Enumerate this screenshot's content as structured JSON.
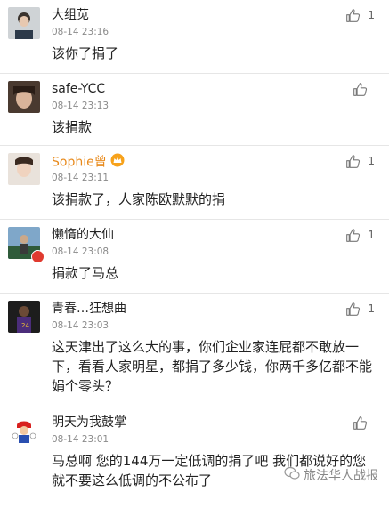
{
  "comments": [
    {
      "username": "大组苋",
      "time": "08-14 23:16",
      "content": "该你了捐了",
      "likes": "1"
    },
    {
      "username": "safe-YCC",
      "time": "08-14 23:13",
      "content": "该捐款",
      "likes": ""
    },
    {
      "username": "Sophie曾",
      "time": "08-14 23:11",
      "content": "该捐款了，人家陈欧默默的捐",
      "likes": "1"
    },
    {
      "username": "懒惰的大仙",
      "time": "08-14 23:08",
      "content": "捐款了马总",
      "likes": "1"
    },
    {
      "username": "青春…狂想曲",
      "time": "08-14 23:03",
      "content": "这天津出了这么大的事，你们企业家连屁都不敢放一下，看看人家明星，都捐了多少钱，你两千多亿都不能娟个零头？",
      "likes": "1"
    },
    {
      "username": "明天为我鼓掌",
      "time": "08-14 23:01",
      "content": "马总啊 您的144万一定低调的捐了吧 我们都说好的您就不要这么低调的不公布了",
      "likes": ""
    }
  ],
  "watermark": "旅法华人战报",
  "colors": {
    "username_gold": "#e8891a",
    "time": "#8a8a8a",
    "divider": "#e6e6e6"
  }
}
